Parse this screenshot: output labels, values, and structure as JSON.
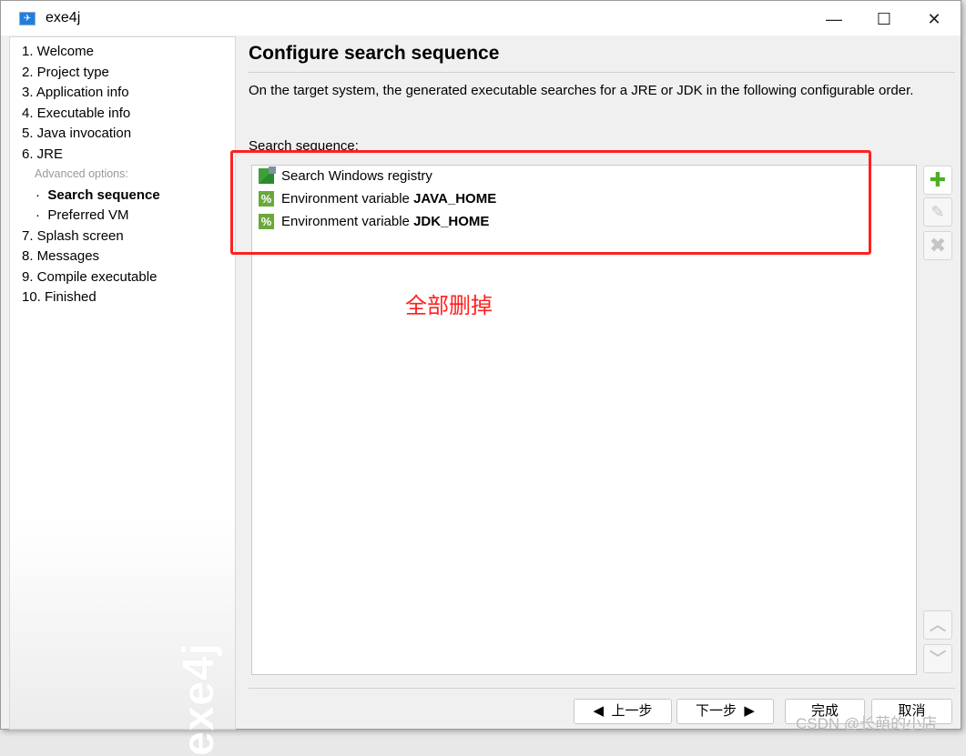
{
  "window": {
    "title": "exe4j"
  },
  "sidebar": {
    "items": [
      "1. Welcome",
      "2. Project type",
      "3. Application info",
      "4. Executable info",
      "5. Java invocation",
      "6. JRE"
    ],
    "advanced_label": "Advanced options:",
    "sub_items": [
      "Search sequence",
      "Preferred VM"
    ],
    "items_after": [
      "7. Splash screen",
      "8. Messages",
      "9. Compile executable",
      "10. Finished"
    ],
    "watermark": "exe4j"
  },
  "main": {
    "title": "Configure search sequence",
    "description": "On the target system, the generated executable searches for a JRE or JDK in the following configurable order.",
    "list_label": "Search sequence:",
    "entries": [
      {
        "icon": "registry-icon",
        "prefix": "Search Windows registry",
        "bold": ""
      },
      {
        "icon": "percent-icon",
        "prefix": "Environment variable ",
        "bold": "JAVA_HOME"
      },
      {
        "icon": "percent-icon",
        "prefix": "Environment variable ",
        "bold": "JDK_HOME"
      }
    ]
  },
  "annotation": {
    "text": "全部删掉",
    "color": "#ff2020"
  },
  "footer": {
    "prev": "上一步",
    "next": "下一步",
    "finish": "完成",
    "cancel": "取消"
  },
  "watermark_csdn": "CSDN @长萌的小店"
}
